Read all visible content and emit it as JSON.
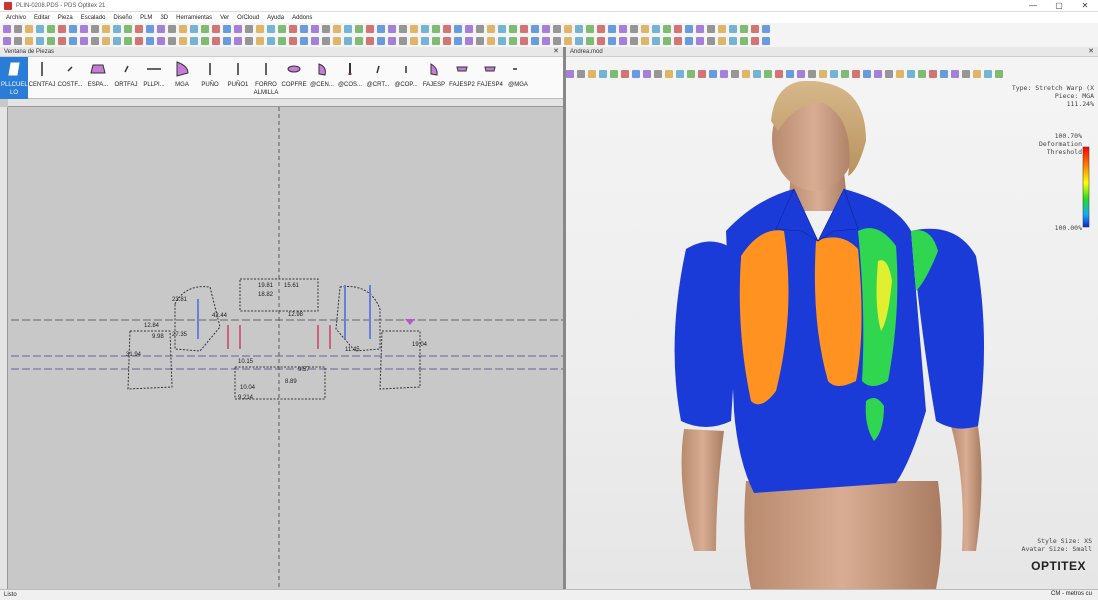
{
  "window": {
    "title": "PLIN-0208.PDS - PDS Optitex 21",
    "controls": [
      "—",
      "▢",
      "✕"
    ]
  },
  "menu": [
    "Archivo",
    "Editar",
    "Pieza",
    "Escalado",
    "Diseño",
    "PLM",
    "3D",
    "Herramientas",
    "Ver",
    "O/Cloud",
    "Ayuda",
    "Addons"
  ],
  "pieces_panel": {
    "title": "Ventana de Piezas",
    "close": "✕"
  },
  "pieces": [
    {
      "label": "PLLCUEL LO",
      "active": true
    },
    {
      "label": "CENTFAJ"
    },
    {
      "label": "COSTF..."
    },
    {
      "label": "ESPA..."
    },
    {
      "label": "ORTFAJ"
    },
    {
      "label": "PLLPI..."
    },
    {
      "label": "MGA"
    },
    {
      "label": "PUÑO"
    },
    {
      "label": "PUÑO1"
    },
    {
      "label": "FORRO ALMILLA"
    },
    {
      "label": "COPFRE"
    },
    {
      "label": "@CEN..."
    },
    {
      "label": "@COS..."
    },
    {
      "label": "@CRT..."
    },
    {
      "label": "@COP..."
    },
    {
      "label": "FAJESP"
    },
    {
      "label": "FAJESP2"
    },
    {
      "label": "FAJESP4"
    },
    {
      "label": "@MGA"
    }
  ],
  "view3d_panel": {
    "title": "Andrea.mod",
    "close": "✕"
  },
  "overlay": {
    "type": "Type: Stretch Warp (X",
    "piece": "Piece: MGA",
    "max": "111.24%",
    "mid": "100.70%",
    "deformation": "Deformation",
    "threshold": "Threshold",
    "min": "100.00%"
  },
  "sizes": {
    "style": "Style Size: XS",
    "avatar": "Avatar Size: Small"
  },
  "brand": "OPTITEX",
  "status": {
    "left": "Listo",
    "right": "CM - metros cu"
  },
  "pattern_labels": [
    "19.81",
    "15.61",
    "18.82",
    "12.98",
    "23.81",
    "27.35",
    "42.44",
    "31.94",
    "11.45",
    "9.214",
    "10.04",
    "8.89",
    "12.84",
    "9.98",
    "19.04",
    "10.15",
    "9.57"
  ],
  "colors": {
    "accent": "#2a7dd6",
    "heat_blue": "#1136d9",
    "heat_orange": "#ff8a1c",
    "heat_green": "#33e04d"
  }
}
